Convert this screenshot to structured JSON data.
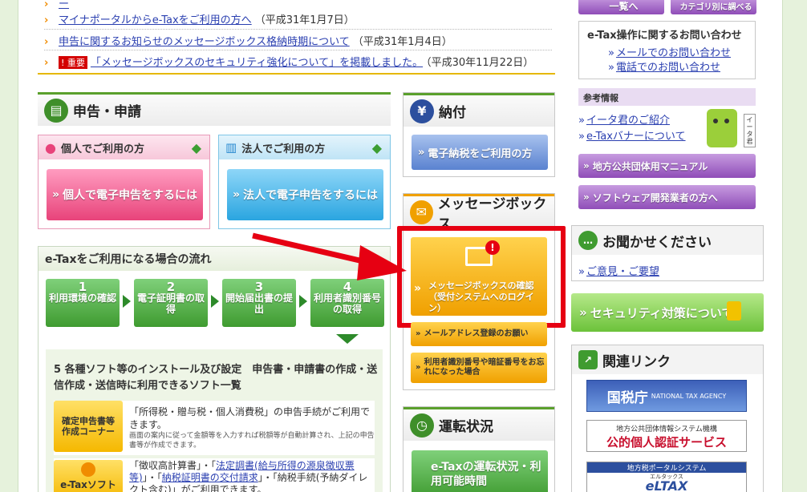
{
  "news": [
    {
      "text": "マイナポータルからe-Taxをご利用の方へ",
      "date": "（平成31年1月7日）"
    },
    {
      "text": "申告に関するお知らせのメッセージボックス格納時期について",
      "date": "（平成31年1月4日）"
    },
    {
      "badge": "重要",
      "text": "「メッセージボックスのセキュリティ強化について」を掲載しました。",
      "date": "（平成30年11月22日）"
    }
  ],
  "shinkoku": {
    "title": "申告・申請",
    "personal": {
      "header": "個人でご利用の方",
      "button": "個人で電子申告をするには"
    },
    "corporate": {
      "header": "法人でご利用の方",
      "button": "法人で電子申告をするには"
    }
  },
  "flow": {
    "title": "e-Taxをご利用になる場合の流れ",
    "steps": [
      {
        "num": "1",
        "label": "利用環境の確認"
      },
      {
        "num": "2",
        "label": "電子証明書の取得"
      },
      {
        "num": "3",
        "label": "開始届出書の提出"
      },
      {
        "num": "4",
        "label": "利用者識別番号の取得"
      }
    ],
    "step5_title": "5 各種ソフト等のインストール及び設定　申告書・申請書の作成・送信作成・送信時に利用できるソフト一覧",
    "soft1": {
      "label": "確定申告書等作成コーナー",
      "desc": "「所得税・贈与税・個人消費税」の申告手続がご利用できます。",
      "note": "画面の案内に従って金額等を入力すれば税額等が自動計算され、上記の申告書等が作成できます。"
    },
    "soft2": {
      "label": "e-Taxソフト",
      "desc_pre": "「徴収高計算書」・「",
      "link1": "法定調書(給与所得の源泉徴収票等)",
      "desc_mid": "」・「",
      "link2": "納税証明書の交付請求",
      "desc_post": "」・「納税手続(予納ダイレクト含む)」がご利用できます。"
    }
  },
  "nofu": {
    "title": "納付",
    "button": "電子納税をご利用の方"
  },
  "message": {
    "title": "メッセージボックス",
    "main_button": "メッセージボックスの確認（受付システムへのログイン）",
    "btn_email": "メールアドレス登録のお願い",
    "btn_forgot": "利用者識別番号や暗証番号をお忘れになった場合"
  },
  "unten": {
    "title": "運転状況",
    "button": "e-Taxの運転状況・利用可能時間"
  },
  "right": {
    "top_btn1": "一覧へ",
    "top_btn2": "カテゴリ別に調べる",
    "inquiry": {
      "title": "e-Tax操作に関するお問い合わせ",
      "mail": "メールでのお問い合わせ",
      "phone": "電話でのお問い合わせ"
    },
    "ref": {
      "title": "参考情報",
      "link1": "イータ君のご紹介",
      "link2": "e-Taxバナーについて",
      "mascot_label": "イータ君"
    },
    "manual_btn": "地方公共団体用マニュアル",
    "software_btn": "ソフトウェア開発業者の方へ",
    "feedback": {
      "title": "お聞かせください",
      "link": "ご意見・ご要望"
    },
    "security_btn": "セキュリティ対策について",
    "links": {
      "title": "関連リンク"
    },
    "banner_nta": {
      "text": "国税庁",
      "sub": "NATIONAL TAX AGENCY"
    },
    "banner_jpki": {
      "top": "地方公共団体情報システム機構",
      "main": "公的個人認証サービス"
    },
    "banner_eltax": {
      "top": "地方税ポータルシステム",
      "main": "eLTAX",
      "ruby": "エルタックス"
    }
  },
  "colors": {
    "green": "#5aa02c",
    "orange": "#f0a000",
    "red_highlight": "#e60012",
    "purple": "#9a5cc4",
    "blue_btn": "#5a82d0",
    "pink_btn": "#e8437a",
    "cyan_btn": "#2aa5e0"
  }
}
